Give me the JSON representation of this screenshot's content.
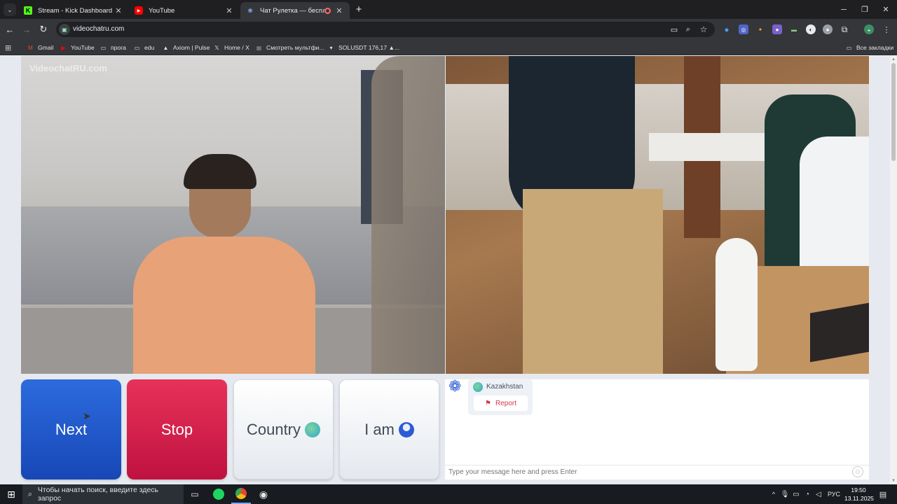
{
  "browser": {
    "tabs": [
      {
        "title": "Stream - Kick Dashboard",
        "icon": "kick-icon",
        "color": "#53fc18",
        "active": false
      },
      {
        "title": "YouTube",
        "icon": "youtube-icon",
        "color": "#ff0000",
        "active": false
      },
      {
        "title": "Чат Рулетка — бесплатный",
        "icon": "chatroulette-icon",
        "color": "#8ab4f8",
        "active": true
      }
    ],
    "new_tab": "+",
    "url": "videochatru.com",
    "bookmarks": [
      "Gmail",
      "YouTube",
      "прога",
      "edu",
      "Axiom | Pulse",
      "Home / X",
      "Смотреть мультфи...",
      "SOLUSDT 176,17 ▲..."
    ],
    "all_bookmarks": "Все закладки"
  },
  "page": {
    "watermark": "VideochatRU.com",
    "buttons": {
      "next": "Next",
      "stop": "Stop",
      "country": "Country",
      "i_am": "I am"
    },
    "partner": {
      "country": "Kazakhstan",
      "report": "Report"
    },
    "chat_placeholder": "Type your message here and press Enter",
    "colors": {
      "next": "#1d53c7",
      "stop": "#d61f4d",
      "accent": "#2b5bd7"
    }
  },
  "taskbar": {
    "search_placeholder": "Чтобы начать поиск, введите здесь запрос",
    "language": "РУС",
    "time": "19:50",
    "date": "13.11.2025"
  }
}
